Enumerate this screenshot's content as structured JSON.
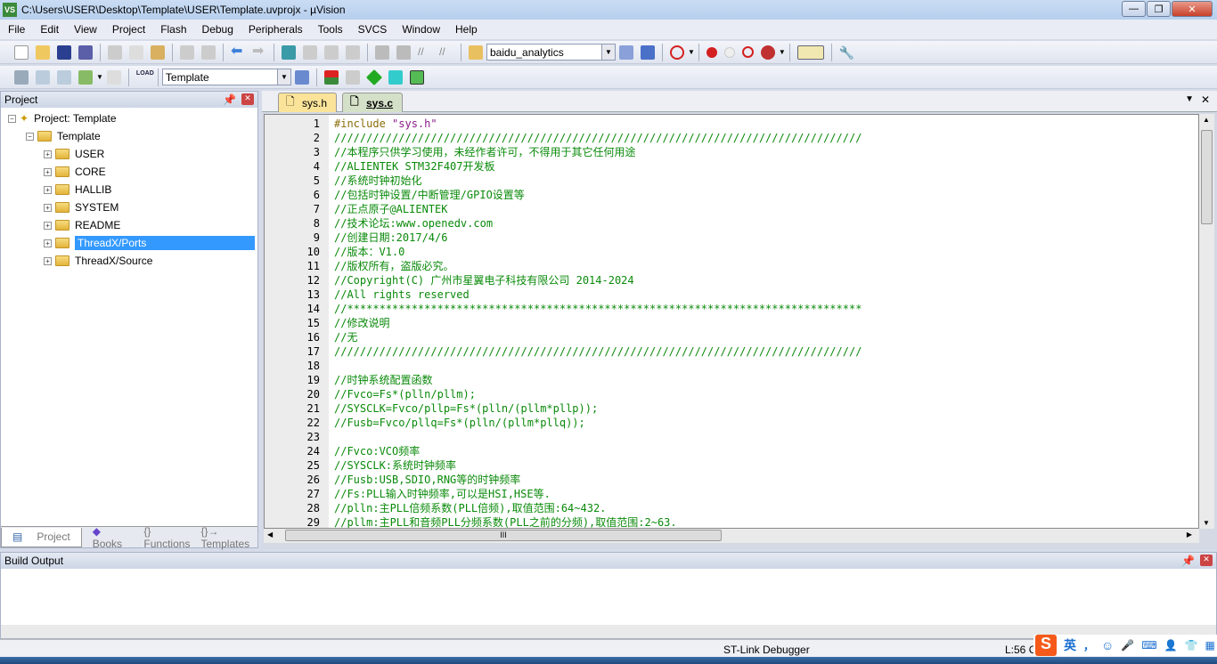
{
  "window": {
    "title": "C:\\Users\\USER\\Desktop\\Template\\USER\\Template.uvprojx - µVision",
    "app_icon": "VS"
  },
  "menu": [
    "File",
    "Edit",
    "View",
    "Project",
    "Flash",
    "Debug",
    "Peripherals",
    "Tools",
    "SVCS",
    "Window",
    "Help"
  ],
  "toolbar": {
    "find_combo": "baidu_analytics",
    "target_combo": "Template",
    "load_label": "LOAD"
  },
  "project_panel": {
    "title": "Project",
    "root": "Project: Template",
    "target": "Template",
    "groups": [
      "USER",
      "CORE",
      "HALLIB",
      "SYSTEM",
      "README",
      "ThreadX/Ports",
      "ThreadX/Source"
    ],
    "selected": "ThreadX/Ports",
    "tabs": [
      "Project",
      "Books",
      "{} Functions",
      "{}→ Templates"
    ]
  },
  "editor": {
    "tabs": [
      {
        "label": "sys.h",
        "active": false
      },
      {
        "label": "sys.c",
        "active": true
      }
    ],
    "lines": [
      "#include \"sys.h\"",
      "//////////////////////////////////////////////////////////////////////////////////",
      "//本程序只供学习使用，未经作者许可，不得用于其它任何用途",
      "//ALIENTEK STM32F407开发板",
      "//系统时钟初始化",
      "//包括时钟设置/中断管理/GPIO设置等",
      "//正点原子@ALIENTEK",
      "//技术论坛:www.openedv.com",
      "//创建日期:2017/4/6",
      "//版本：V1.0",
      "//版权所有，盗版必究。",
      "//Copyright(C) 广州市星翼电子科技有限公司 2014-2024",
      "//All rights reserved",
      "//********************************************************************************",
      "//修改说明",
      "//无",
      "//////////////////////////////////////////////////////////////////////////////////",
      "",
      "//时钟系统配置函数",
      "//Fvco=Fs*(plln/pllm);",
      "//SYSCLK=Fvco/pllp=Fs*(plln/(pllm*pllp));",
      "//Fusb=Fvco/pllq=Fs*(plln/(pllm*pllq));",
      "",
      "//Fvco:VCO频率",
      "//SYSCLK:系统时钟频率",
      "//Fusb:USB,SDIO,RNG等的时钟频率",
      "//Fs:PLL输入时钟频率,可以是HSI,HSE等.",
      "//plln:主PLL倍频系数(PLL倍频),取值范围:64~432.",
      "//pllm:主PLL和音频PLL分频系数(PLL之前的分频),取值范围:2~63."
    ],
    "hscroll_thumb": "III"
  },
  "build_output": {
    "title": "Build Output"
  },
  "status": {
    "debugger": "ST-Link Debugger",
    "position": "L:56 C:"
  },
  "ime": {
    "logo": "S",
    "mode": "英",
    "punct": "，"
  },
  "colors": {
    "comment": "#0a8a0a",
    "preprocessor": "#8a6d0a",
    "string": "#8a1a8a",
    "selection": "#3399ff",
    "breakpoint": "#d42020"
  }
}
